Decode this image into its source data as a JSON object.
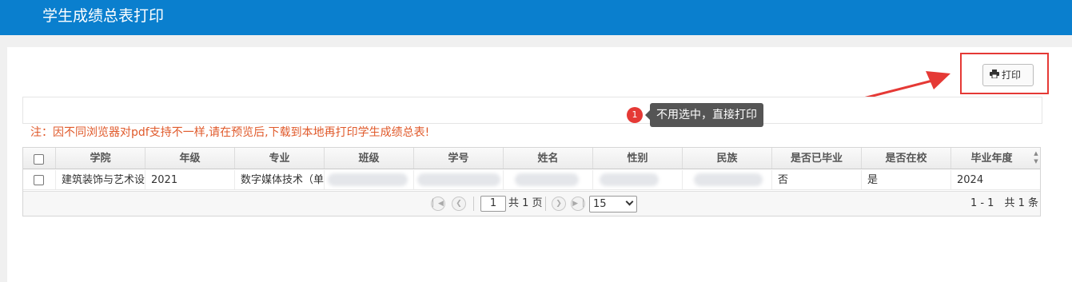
{
  "header": {
    "title": "学生成绩总表打印"
  },
  "toolbar": {
    "print_label": "打印"
  },
  "callout": {
    "number": "1",
    "text": "不用选中，直接打印"
  },
  "note": "注：因不同浏览器对pdf支持不一样,请在预览后,下载到本地再打印学生成绩总表!",
  "table": {
    "columns": [
      "学院",
      "年级",
      "专业",
      "班级",
      "学号",
      "姓名",
      "性别",
      "民族",
      "是否已毕业",
      "是否在校",
      "毕业年度"
    ],
    "rows": [
      [
        "建筑装饰与艺术设",
        "2021",
        "数字媒体技术（单",
        "",
        "",
        "",
        "",
        "",
        "否",
        "是",
        "2024"
      ]
    ]
  },
  "pager": {
    "current_page": "1",
    "total_pages": "共 1 页",
    "page_size": "15",
    "info": "1 - 1　共 1 条"
  },
  "colors": {
    "header": "#0a7fce",
    "note": "#e05a2b",
    "highlight": "#e53935"
  }
}
